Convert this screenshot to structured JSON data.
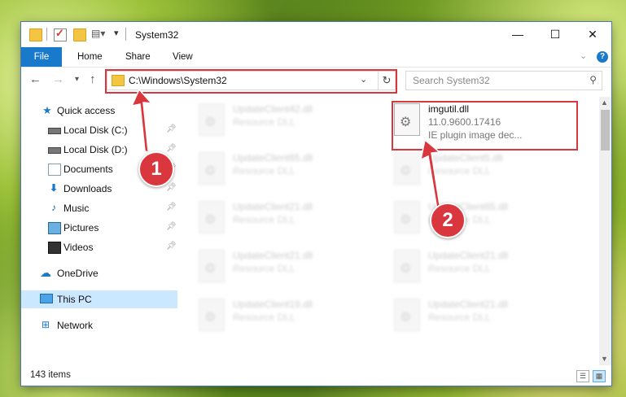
{
  "window": {
    "title": "System32",
    "controls": {
      "minimize": "—",
      "maximize": "☐",
      "close": "✕"
    }
  },
  "ribbon": {
    "tabs": [
      "File",
      "Home",
      "Share",
      "View"
    ],
    "help": "?"
  },
  "address": {
    "path": "C:\\Windows\\System32",
    "search_placeholder": "Search System32"
  },
  "sidebar": {
    "items": [
      {
        "label": "Quick access",
        "icon": "star-icon",
        "pinned": false
      },
      {
        "label": "Local Disk (C:)",
        "icon": "disk-icon",
        "pinned": true
      },
      {
        "label": "Local Disk (D:)",
        "icon": "disk-icon",
        "pinned": true
      },
      {
        "label": "Documents",
        "icon": "documents-icon",
        "pinned": true
      },
      {
        "label": "Downloads",
        "icon": "download-icon",
        "pinned": true
      },
      {
        "label": "Music",
        "icon": "music-icon",
        "pinned": true
      },
      {
        "label": "Pictures",
        "icon": "pictures-icon",
        "pinned": true
      },
      {
        "label": "Videos",
        "icon": "videos-icon",
        "pinned": true
      },
      {
        "label": "OneDrive",
        "icon": "onedrive-icon",
        "pinned": false
      },
      {
        "label": "This PC",
        "icon": "computer-icon",
        "pinned": false,
        "selected": true
      },
      {
        "label": "Network",
        "icon": "network-icon",
        "pinned": false
      }
    ]
  },
  "files": {
    "left_column": [
      {
        "name": "UpdateClient42.dll",
        "type": "Resource DLL"
      },
      {
        "name": "UpdateClient65.dll",
        "type": "Resource DLL"
      },
      {
        "name": "UpdateClient21.dll",
        "type": "Resource DLL"
      },
      {
        "name": "UpdateClient21.dll",
        "type": "Resource DLL"
      },
      {
        "name": "UpdateClient19.dll",
        "type": "Resource DLL"
      }
    ],
    "right_column": [
      {
        "name": "UpdateClient5.dll",
        "type": "Resource DLL"
      },
      {
        "name": "UpdateClient65.dll",
        "type": "Resource DLL"
      },
      {
        "name": "UpdateClient21.dll",
        "type": "Resource DLL"
      },
      {
        "name": "UpdateClient21.dll",
        "type": "Resource DLL"
      }
    ],
    "highlighted": {
      "name": "imgutil.dll",
      "version": "11.0.9600.17416",
      "description": "IE plugin image dec..."
    }
  },
  "status": {
    "item_count": "143 items"
  },
  "annotations": {
    "step1": "1",
    "step2": "2",
    "color": "#d9363e"
  }
}
